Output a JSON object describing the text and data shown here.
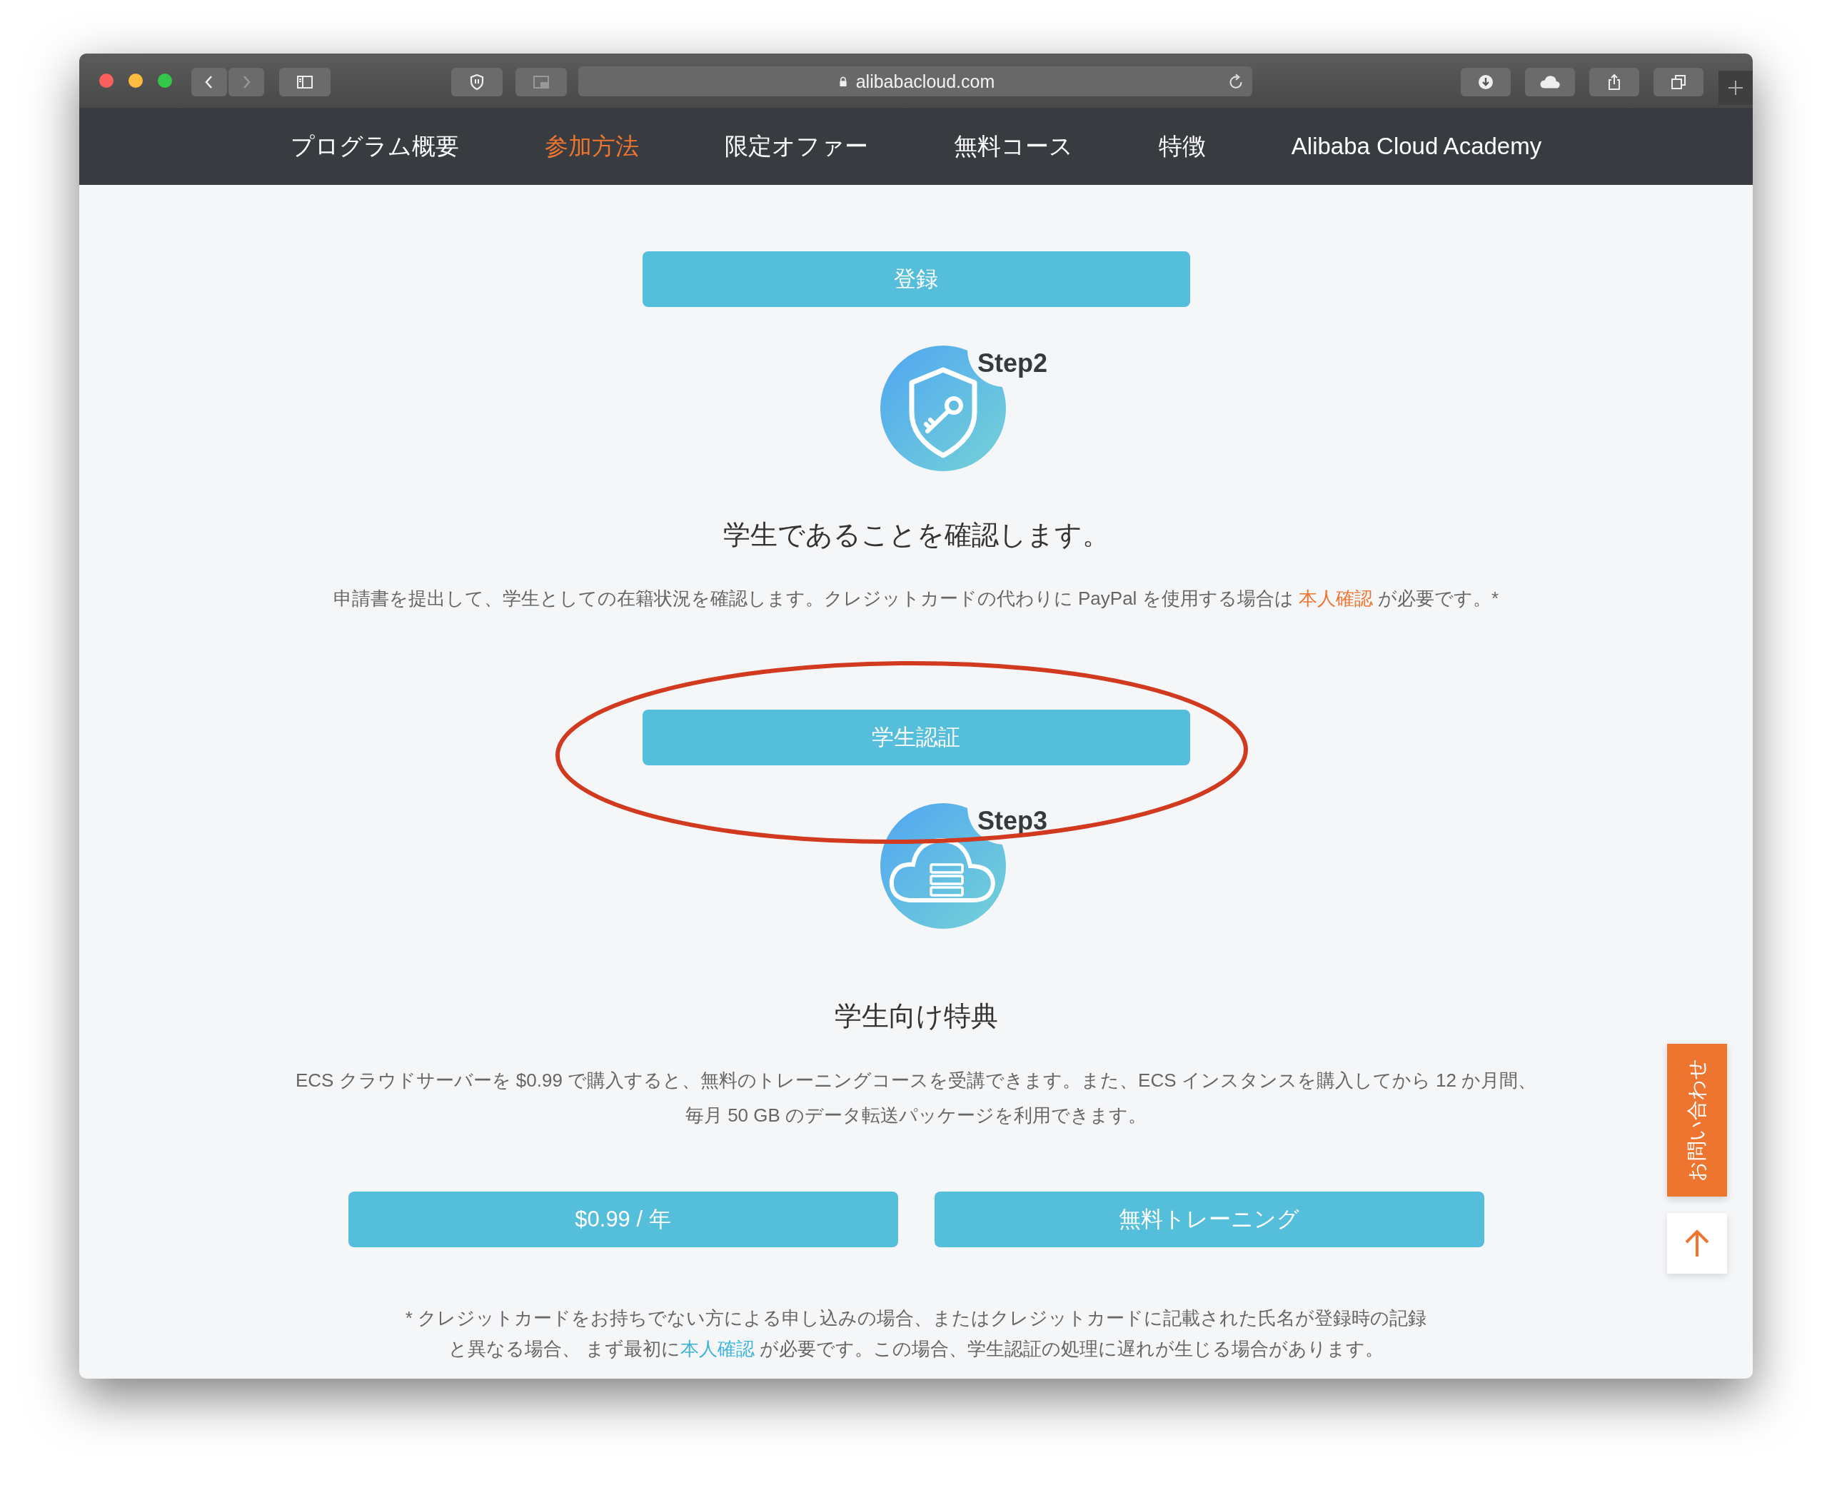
{
  "browser": {
    "url": "alibabacloud.com"
  },
  "nav": [
    {
      "label": "プログラム概要",
      "selected": false
    },
    {
      "label": "参加方法",
      "selected": true
    },
    {
      "label": "限定オファー",
      "selected": false
    },
    {
      "label": "無料コース",
      "selected": false
    },
    {
      "label": "特徴",
      "selected": false
    },
    {
      "label": "Alibaba Cloud Academy",
      "selected": false
    }
  ],
  "register_button": "登録",
  "step2": {
    "label": "Step2",
    "heading": "学生であることを確認します。",
    "text_before": "申請書を提出して、学生としての在籍状況を確認します。クレジットカードの代わりに PayPal を使用する場合は ",
    "link": "本人確認",
    "text_after": " が必要です。*"
  },
  "verify_button": "学生認証",
  "step3": {
    "label": "Step3",
    "heading": "学生向け特典",
    "lines": [
      "ECS クラウドサーバーを $0.99 で購入すると、無料のトレーニングコースを受講できます。また、ECS インスタンスを購入してから 12 か月間、",
      "毎月 50 GB のデータ転送パッケージを利用できます。"
    ]
  },
  "buttons": [
    "$0.99 / 年",
    "無料トレーニング"
  ],
  "footnote": {
    "line1": "* クレジットカードをお持ちでない方による申し込みの場合、またはクレジットカードに記載された氏名が登録時の記録",
    "before": "と異なる場合、 まず最初に",
    "link": "本人確認",
    "after": " が必要です。この場合、学生認証の処理に遅れが生じる場合があります。"
  },
  "contact_tab": "お問い合わせ"
}
